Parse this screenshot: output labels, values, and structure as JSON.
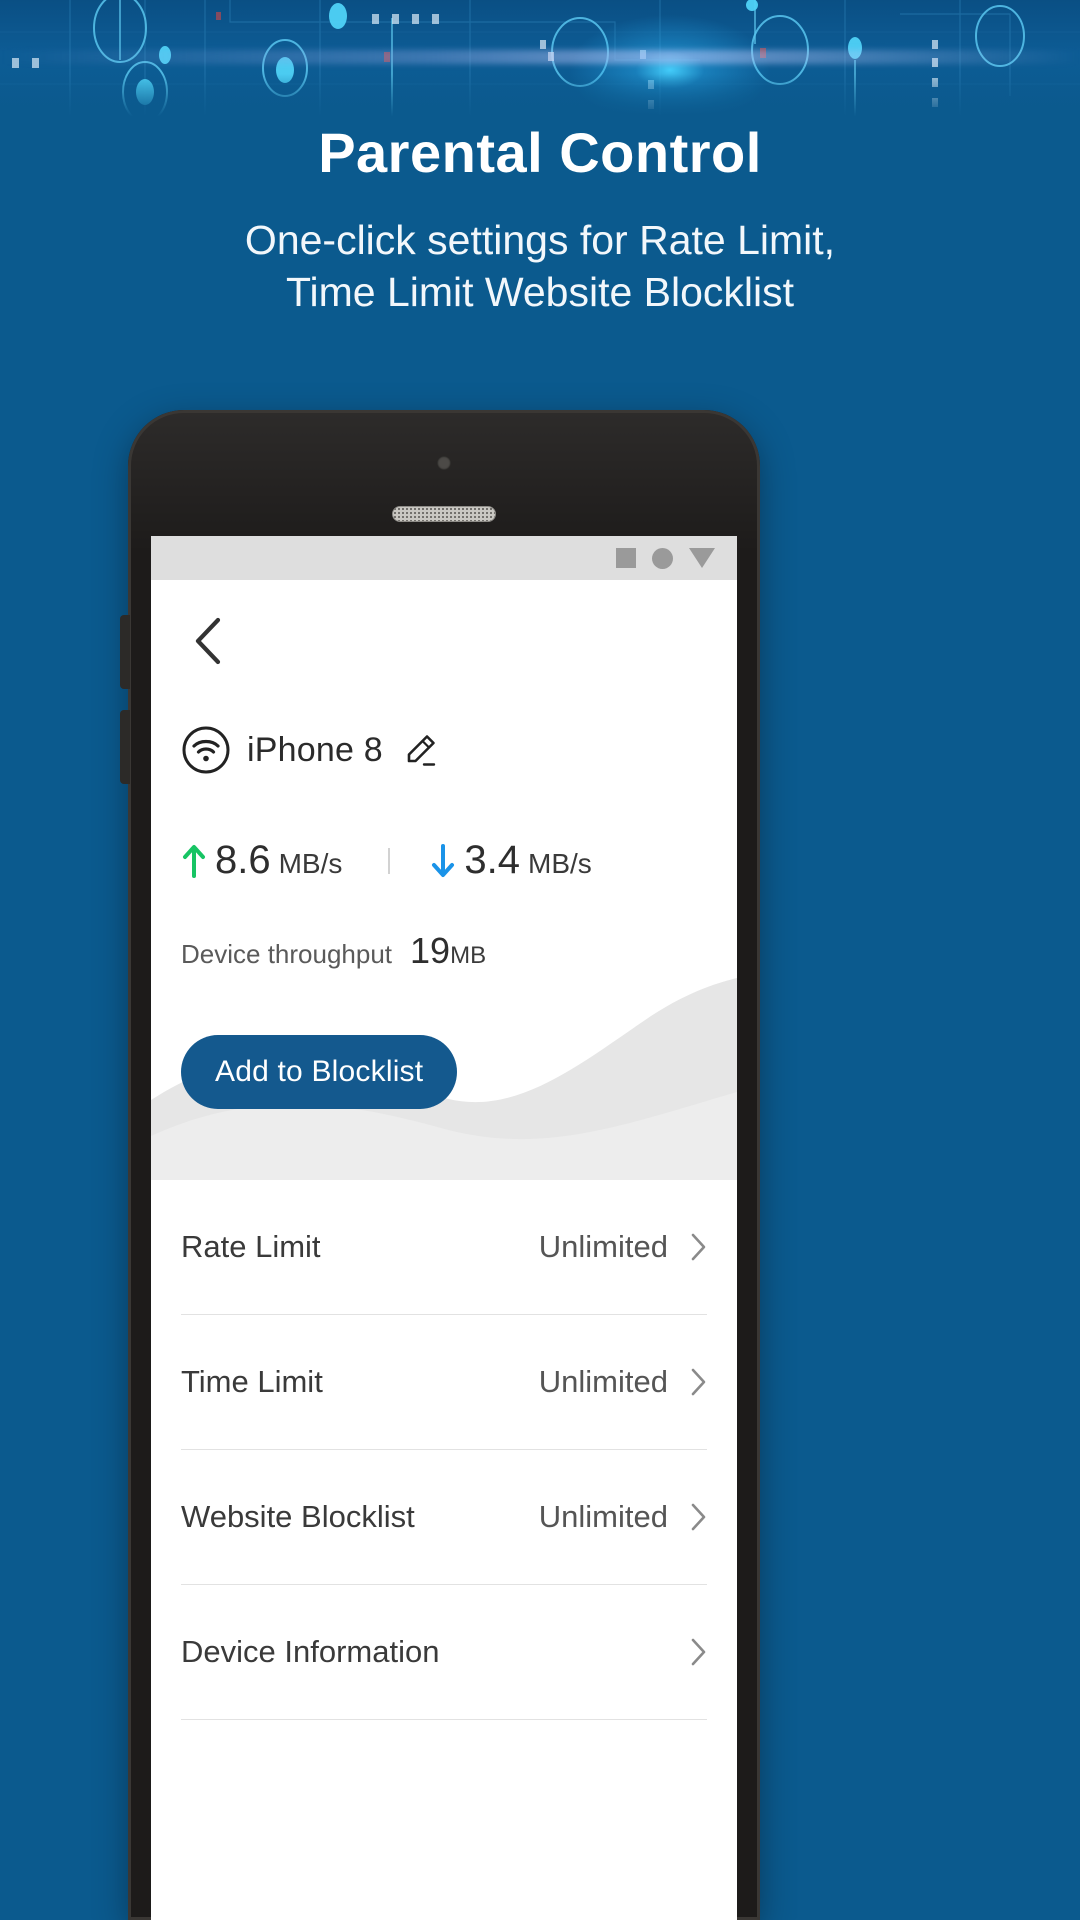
{
  "promo": {
    "title": "Parental Control",
    "subtitle_line1": "One-click settings for Rate Limit,",
    "subtitle_line2": "Time Limit Website Blocklist"
  },
  "colors": {
    "background": "#0b5a8e",
    "accent_button": "#14598e",
    "upload_arrow": "#17c464",
    "download_arrow": "#1a93e8",
    "status_icon": "#9a9a9a",
    "divider": "#e2e2e2"
  },
  "statusbar": {
    "icons": [
      "square-icon",
      "circle-icon",
      "triangle-down-icon"
    ]
  },
  "app": {
    "back_icon": "chevron-left-icon",
    "device": {
      "wifi_icon": "wifi-circle-icon",
      "name": "iPhone 8",
      "edit_icon": "pencil-icon"
    },
    "speeds": {
      "upload": {
        "arrow": "arrow-up-icon",
        "value": "8.6",
        "unit": "MB/s"
      },
      "download": {
        "arrow": "arrow-down-icon",
        "value": "3.4",
        "unit": "MB/s"
      }
    },
    "throughput": {
      "label": "Device throughput",
      "value": "19",
      "unit": "MB"
    },
    "block_button": "Add to Blocklist",
    "settings": [
      {
        "label": "Rate Limit",
        "value": "Unlimited",
        "chevron": "chevron-right-icon"
      },
      {
        "label": "Time Limit",
        "value": "Unlimited",
        "chevron": "chevron-right-icon"
      },
      {
        "label": "Website Blocklist",
        "value": "Unlimited",
        "chevron": "chevron-right-icon"
      },
      {
        "label": "Device Information",
        "value": "",
        "chevron": "chevron-right-icon"
      }
    ]
  }
}
